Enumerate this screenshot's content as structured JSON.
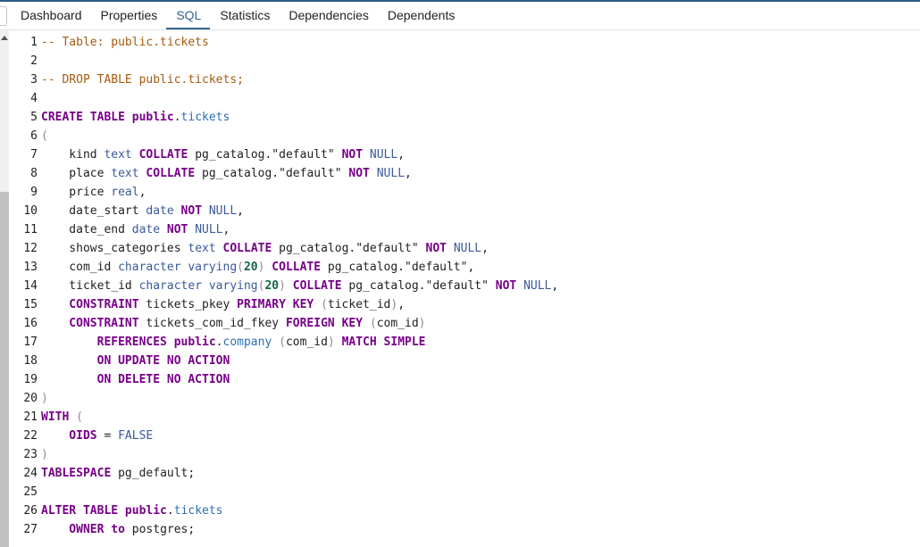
{
  "tabs": [
    {
      "label": "Dashboard",
      "active": false
    },
    {
      "label": "Properties",
      "active": false
    },
    {
      "label": "SQL",
      "active": true
    },
    {
      "label": "Statistics",
      "active": false
    },
    {
      "label": "Dependencies",
      "active": false
    },
    {
      "label": "Dependents",
      "active": false
    }
  ],
  "colors": {
    "active_tab": "#326690",
    "comment": "#a55a0f",
    "keyword": "#770088",
    "type": "#3a5a9a",
    "number": "#116644",
    "bracket": "#998899",
    "definition": "#2d6fb0"
  },
  "lines": [
    {
      "n": "1",
      "tokens": [
        [
          "cm",
          "-- Table: public.tickets"
        ]
      ]
    },
    {
      "n": "2",
      "tokens": []
    },
    {
      "n": "3",
      "tokens": [
        [
          "cm",
          "-- DROP TABLE public.tickets;"
        ]
      ]
    },
    {
      "n": "4",
      "tokens": []
    },
    {
      "n": "5",
      "tokens": [
        [
          "kw",
          "CREATE TABLE public"
        ],
        [
          "",
          "."
        ],
        [
          "df",
          "tickets"
        ]
      ]
    },
    {
      "n": "6",
      "tokens": [
        [
          "br",
          "("
        ]
      ]
    },
    {
      "n": "7",
      "tokens": [
        [
          "",
          "    kind "
        ],
        [
          "ty",
          "text"
        ],
        [
          "",
          " "
        ],
        [
          "kw",
          "COLLATE"
        ],
        [
          "",
          " pg_catalog.\"default\" "
        ],
        [
          "kw",
          "NOT"
        ],
        [
          "",
          " "
        ],
        [
          "ty",
          "NULL"
        ],
        [
          "",
          ","
        ]
      ]
    },
    {
      "n": "8",
      "tokens": [
        [
          "",
          "    place "
        ],
        [
          "ty",
          "text"
        ],
        [
          "",
          " "
        ],
        [
          "kw",
          "COLLATE"
        ],
        [
          "",
          " pg_catalog.\"default\" "
        ],
        [
          "kw",
          "NOT"
        ],
        [
          "",
          " "
        ],
        [
          "ty",
          "NULL"
        ],
        [
          "",
          ","
        ]
      ]
    },
    {
      "n": "9",
      "tokens": [
        [
          "",
          "    price "
        ],
        [
          "ty",
          "real"
        ],
        [
          "",
          ","
        ]
      ]
    },
    {
      "n": "10",
      "tokens": [
        [
          "",
          "    date_start "
        ],
        [
          "ty",
          "date"
        ],
        [
          "",
          " "
        ],
        [
          "kw",
          "NOT"
        ],
        [
          "",
          " "
        ],
        [
          "ty",
          "NULL"
        ],
        [
          "",
          ","
        ]
      ]
    },
    {
      "n": "11",
      "tokens": [
        [
          "",
          "    date_end "
        ],
        [
          "ty",
          "date"
        ],
        [
          "",
          " "
        ],
        [
          "kw",
          "NOT"
        ],
        [
          "",
          " "
        ],
        [
          "ty",
          "NULL"
        ],
        [
          "",
          ","
        ]
      ]
    },
    {
      "n": "12",
      "tokens": [
        [
          "",
          "    shows_categories "
        ],
        [
          "ty",
          "text"
        ],
        [
          "",
          " "
        ],
        [
          "kw",
          "COLLATE"
        ],
        [
          "",
          " pg_catalog.\"default\" "
        ],
        [
          "kw",
          "NOT"
        ],
        [
          "",
          " "
        ],
        [
          "ty",
          "NULL"
        ],
        [
          "",
          ","
        ]
      ]
    },
    {
      "n": "13",
      "tokens": [
        [
          "",
          "    com_id "
        ],
        [
          "ty",
          "character varying"
        ],
        [
          "br",
          "("
        ],
        [
          "num",
          "20"
        ],
        [
          "br",
          ")"
        ],
        [
          "",
          " "
        ],
        [
          "kw",
          "COLLATE"
        ],
        [
          "",
          " pg_catalog.\"default\","
        ]
      ]
    },
    {
      "n": "14",
      "tokens": [
        [
          "",
          "    ticket_id "
        ],
        [
          "ty",
          "character varying"
        ],
        [
          "br",
          "("
        ],
        [
          "num",
          "20"
        ],
        [
          "br",
          ")"
        ],
        [
          "",
          " "
        ],
        [
          "kw",
          "COLLATE"
        ],
        [
          "",
          " pg_catalog.\"default\" "
        ],
        [
          "kw",
          "NOT"
        ],
        [
          "",
          " "
        ],
        [
          "ty",
          "NULL"
        ],
        [
          "",
          ","
        ]
      ]
    },
    {
      "n": "15",
      "tokens": [
        [
          "kw",
          "    CONSTRAINT"
        ],
        [
          "",
          " tickets_pkey "
        ],
        [
          "kw",
          "PRIMARY KEY"
        ],
        [
          "",
          " "
        ],
        [
          "br",
          "("
        ],
        [
          "",
          "ticket_id"
        ],
        [
          "br",
          ")"
        ],
        [
          "",
          ","
        ]
      ]
    },
    {
      "n": "16",
      "tokens": [
        [
          "kw",
          "    CONSTRAINT"
        ],
        [
          "",
          " tickets_com_id_fkey "
        ],
        [
          "kw",
          "FOREIGN KEY"
        ],
        [
          "",
          " "
        ],
        [
          "br",
          "("
        ],
        [
          "",
          "com_id"
        ],
        [
          "br",
          ")"
        ]
      ]
    },
    {
      "n": "17",
      "tokens": [
        [
          "kw",
          "        REFERENCES public"
        ],
        [
          "",
          "."
        ],
        [
          "df",
          "company"
        ],
        [
          "",
          " "
        ],
        [
          "br",
          "("
        ],
        [
          "",
          "com_id"
        ],
        [
          "br",
          ")"
        ],
        [
          "",
          " "
        ],
        [
          "kw",
          "MATCH SIMPLE"
        ]
      ]
    },
    {
      "n": "18",
      "tokens": [
        [
          "kw",
          "        ON UPDATE NO ACTION"
        ]
      ]
    },
    {
      "n": "19",
      "tokens": [
        [
          "kw",
          "        ON DELETE NO ACTION"
        ]
      ]
    },
    {
      "n": "20",
      "tokens": [
        [
          "br",
          ")"
        ]
      ]
    },
    {
      "n": "21",
      "tokens": [
        [
          "kw",
          "WITH"
        ],
        [
          "",
          " "
        ],
        [
          "br",
          "("
        ]
      ]
    },
    {
      "n": "22",
      "tokens": [
        [
          "kw",
          "    OIDS"
        ],
        [
          "",
          " = "
        ],
        [
          "ty",
          "FALSE"
        ]
      ]
    },
    {
      "n": "23",
      "tokens": [
        [
          "br",
          ")"
        ]
      ]
    },
    {
      "n": "24",
      "tokens": [
        [
          "kw",
          "TABLESPACE"
        ],
        [
          "",
          " pg_default;"
        ]
      ]
    },
    {
      "n": "25",
      "tokens": []
    },
    {
      "n": "26",
      "tokens": [
        [
          "kw",
          "ALTER TABLE public"
        ],
        [
          "",
          "."
        ],
        [
          "df",
          "tickets"
        ]
      ]
    },
    {
      "n": "27",
      "tokens": [
        [
          "kw",
          "    OWNER"
        ],
        [
          "",
          " "
        ],
        [
          "kw",
          "to"
        ],
        [
          "",
          " postgres;"
        ]
      ]
    }
  ]
}
